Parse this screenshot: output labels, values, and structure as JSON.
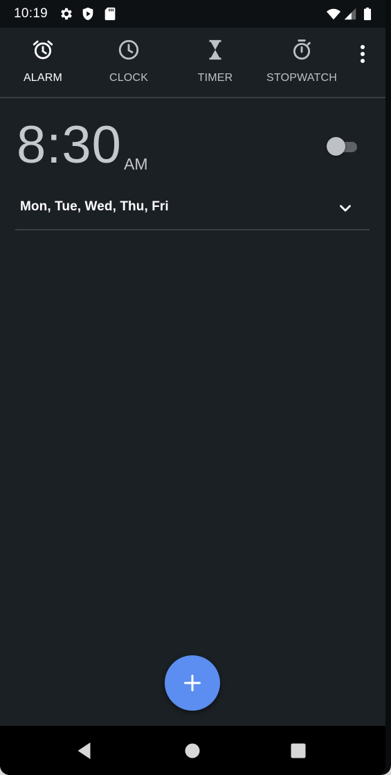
{
  "status_bar": {
    "time": "10:19",
    "icons": [
      "gear-icon",
      "shield-play-icon",
      "sd-card-icon",
      "wifi-icon",
      "signal-icon",
      "battery-icon"
    ]
  },
  "tabs": [
    {
      "label": "ALARM",
      "icon": "alarm-clock-icon",
      "active": true
    },
    {
      "label": "CLOCK",
      "icon": "clock-icon",
      "active": false
    },
    {
      "label": "TIMER",
      "icon": "hourglass-icon",
      "active": false
    },
    {
      "label": "STOPWATCH",
      "icon": "stopwatch-icon",
      "active": false
    }
  ],
  "overflow_menu_icon": "more-vert-icon",
  "alarms": [
    {
      "time": "8:30",
      "ampm": "AM",
      "days": "Mon, Tue, Wed, Thu, Fri",
      "enabled": false
    }
  ],
  "fab": {
    "icon": "plus-icon"
  },
  "nav_bar": {
    "buttons": [
      "back-icon",
      "home-icon",
      "recents-icon"
    ]
  },
  "colors": {
    "background": "#1b2025",
    "status_bar": "#0e1114",
    "fab": "#5b8ef0",
    "text_primary": "#ffffff",
    "text_secondary": "#bdc1c6"
  }
}
